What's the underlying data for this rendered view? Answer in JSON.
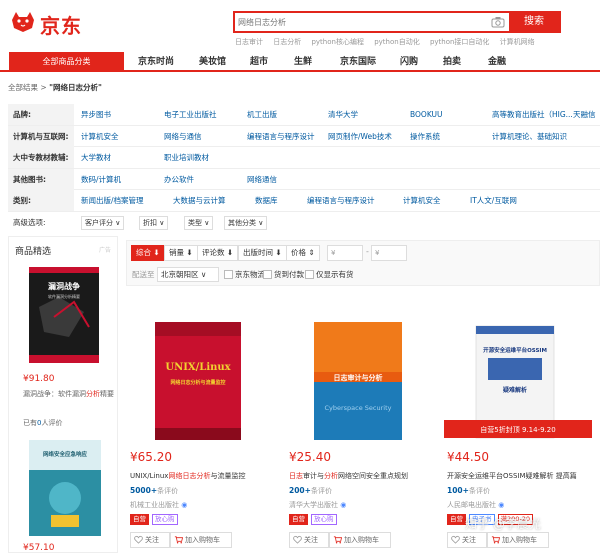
{
  "header": {
    "logo_text": "京东",
    "search_placeholder": "网络日志分析",
    "search_button": "搜索",
    "hotwords": [
      "日志审计",
      "日志分析",
      "python核心编程",
      "python自动化",
      "python接口自动化",
      "计算机网络"
    ]
  },
  "nav": {
    "all_categories": "全部商品分类",
    "items": [
      "京东时尚",
      "美妆馆",
      "超市",
      "生鲜",
      "京东国际",
      "闪购",
      "拍卖",
      "金融"
    ]
  },
  "breadcrumb": {
    "root": "全部结果",
    "sep": ">",
    "query": "\"网络日志分析\""
  },
  "filters": [
    {
      "label": "品牌:",
      "values": [
        "异步图书",
        "电子工业出版社",
        "机工出版",
        "清华大学",
        "BOOKUU",
        "高等教育出版社（HIG...",
        "天融信"
      ]
    },
    {
      "label": "计算机与互联网:",
      "values": [
        "计算机安全",
        "网络与通信",
        "编程语言与程序设计",
        "网页制作/Web技术",
        "操作系统",
        "计算机理论、基础知识"
      ]
    },
    {
      "label": "大中专教材教辅:",
      "values": [
        "大学教材",
        "职业培训教材"
      ]
    },
    {
      "label": "其他图书:",
      "values": [
        "数码/计算机",
        "办公软件",
        "网络通信"
      ]
    },
    {
      "label": "类别:",
      "values": [
        "新闻出版/档案管理",
        "大数据与云计算",
        "数据库",
        "编程语言与程序设计",
        "计算机安全",
        "IT人文/互联网"
      ]
    }
  ],
  "advanced": {
    "label": "高级选项:",
    "options": [
      "客户评分",
      "折扣",
      "类型",
      "其他分类"
    ]
  },
  "sidebar": {
    "title": "商品精选",
    "ad": "广告",
    "items": [
      {
        "price": "¥91.80",
        "name_pre": "漏洞战争：软件漏洞",
        "name_hl": "分析",
        "name_post": "精要",
        "comments": "已有",
        "comments_num": "0",
        "comments_suffix": "人评价",
        "cover_title": "漏洞战争",
        "cover_sub": "软件漏洞分析精要"
      },
      {
        "price": "¥57.10",
        "cover_title": "网络安全应急响应"
      }
    ]
  },
  "sort": {
    "options": [
      "综合 ⬇",
      "销量 ⬇",
      "评论数 ⬇",
      "出版时间 ⬇",
      "价格 ⇕"
    ],
    "price_from": "¥",
    "price_to": "¥",
    "dash": "-",
    "ship_label": "配送至",
    "location": "北京朝阳区 ∨",
    "checks": [
      "京东物流",
      "货到付款",
      "仅显示有货"
    ]
  },
  "products": [
    {
      "price": "¥65.20",
      "name_pre": "UNIX/Linux",
      "name_hl": "网络日志分析",
      "name_post": "与流量监控",
      "comments_num": "5000+",
      "comments_suffix": "条评价",
      "shop": "机械工业出版社",
      "tags": [
        "自营",
        "放心购"
      ],
      "actions": [
        "关注",
        "加入购物车"
      ],
      "cover_title": "UNIX/Linux",
      "cover_sub": "网络日志分析与流量监控"
    },
    {
      "price": "¥25.40",
      "name_hl": "日志",
      "name_pre": "审计与",
      "name_hl2": "分析",
      "name_post": "网络空间安全重点规划",
      "comments_num": "200+",
      "comments_suffix": "条评价",
      "shop": "清华大学出版社",
      "tags": [
        "自营",
        "放心购"
      ],
      "actions": [
        "关注",
        "加入购物车"
      ],
      "cover_title": "日志审计与分析",
      "cover_sub": "Cyberspace Security"
    },
    {
      "price": "¥44.50",
      "name_pre": "开源安全运维平台OSSIM疑难解析 提高篇",
      "comments_num": "100+",
      "comments_suffix": "条评价",
      "shop": "人民邮电出版社",
      "tags": [
        "自营",
        "电子书",
        "满200-20"
      ],
      "actions": [
        "关注",
        "加入购物车"
      ],
      "cover_title": "开源安全运维平台OSSIM",
      "cover_sub": "疑难解析",
      "banner": "自营5折封顶 9.14-9.20"
    }
  ],
  "watermark": "知乎 @李晨光",
  "colors": {
    "brand": "#e1251b",
    "link": "#005aa0"
  }
}
